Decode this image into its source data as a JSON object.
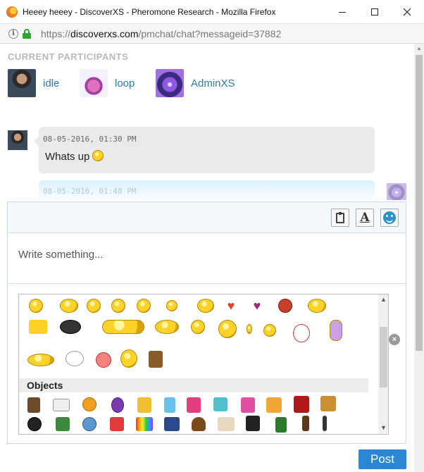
{
  "window": {
    "title": "Heeey heeey - DiscoverXS - Pheromone Research - Mozilla Firefox",
    "url_prefix": "https://",
    "url_domain": "discoverxs.com",
    "url_path": "/pmchat/chat?messageid=37882"
  },
  "participants": {
    "heading": "CURRENT PARTICIPANTS",
    "list": [
      {
        "name": "idle"
      },
      {
        "name": "loop"
      },
      {
        "name": "AdminXS"
      }
    ]
  },
  "messages": [
    {
      "timestamp": "08-05-2016, 01:30 PM",
      "text": "Whats up"
    },
    {
      "timestamp": "08-05-2016, 01:48 PM"
    }
  ],
  "composer": {
    "placeholder": "Write something...",
    "tool_font_label": "A",
    "close_label": "×",
    "post_label": "Post"
  },
  "emoji_panel": {
    "section_objects": "Objects"
  },
  "colors": {
    "accent": "#2a86d4",
    "link": "#2b7bb0",
    "heading_gray": "#b9b9b9"
  }
}
